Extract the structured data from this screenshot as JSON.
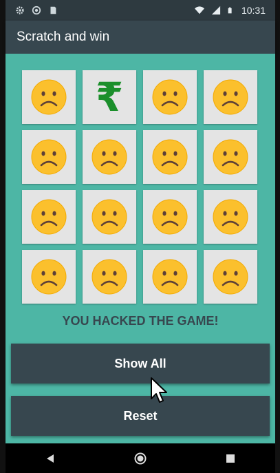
{
  "status_bar": {
    "time": "10:31",
    "icons": [
      "gear-icon",
      "circle-icon",
      "sd-card-icon",
      "wifi-icon",
      "signal-icon",
      "battery-icon"
    ]
  },
  "app_bar": {
    "title": "Scratch and win"
  },
  "grid": {
    "rows": 4,
    "columns": 4,
    "tiles": [
      "sad-face",
      "rupee",
      "sad-face",
      "sad-face",
      "sad-face",
      "sad-face",
      "sad-face",
      "sad-face",
      "sad-face",
      "sad-face",
      "sad-face",
      "sad-face",
      "sad-face",
      "sad-face",
      "sad-face",
      "sad-face"
    ],
    "rupee_symbol": "₹"
  },
  "message": "YOU HACKED THE GAME!",
  "buttons": {
    "show_all": "Show All",
    "reset": "Reset"
  },
  "nav_bar": {
    "icons": [
      "back-icon",
      "home-icon",
      "recents-icon"
    ]
  },
  "colors": {
    "status_bar": "#2e3a40",
    "app_bar": "#37474f",
    "content_bg": "#4db6a5",
    "tile_bg": "#e4e4e4",
    "emoji_face": "#fbc02d",
    "rupee": "#1b8f2b",
    "button_bg": "#37474f"
  }
}
